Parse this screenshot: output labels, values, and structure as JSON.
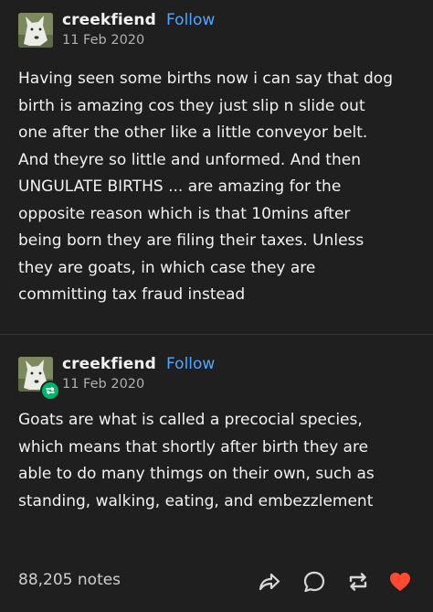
{
  "posts": [
    {
      "username": "creekfiend",
      "follow_label": "Follow",
      "date": "11 Feb 2020",
      "is_reblog": false,
      "lines": [
        "Having seen some births now i can say that dog",
        "birth is amazing cos they just slip n slide out",
        "one after the other like a little conveyor belt.",
        "And theyre so little and unformed. And then",
        "UNGULATE BIRTHS ... are amazing for the",
        "opposite reason which is that 10mins after",
        "being born they are filing their taxes. Unless",
        "they are goats, in which case they are",
        "committing tax fraud instead"
      ]
    },
    {
      "username": "creekfiend",
      "follow_label": "Follow",
      "date": "11 Feb 2020",
      "is_reblog": true,
      "lines": [
        "Goats are what is called a precocial species,",
        "which means that shortly after birth they are",
        "able to do many thimgs on their own, such as",
        "standing,  walking, eating, and embezzlement"
      ]
    }
  ],
  "footer": {
    "notes": "88,205 notes",
    "icons": [
      "share-icon",
      "reply-icon",
      "reblog-icon",
      "heart-icon"
    ],
    "heart_color": "#ff4930"
  },
  "colors": {
    "background": "#1f1f1f",
    "follow": "#4ea7ff",
    "reblog_badge": "#00b46a"
  }
}
